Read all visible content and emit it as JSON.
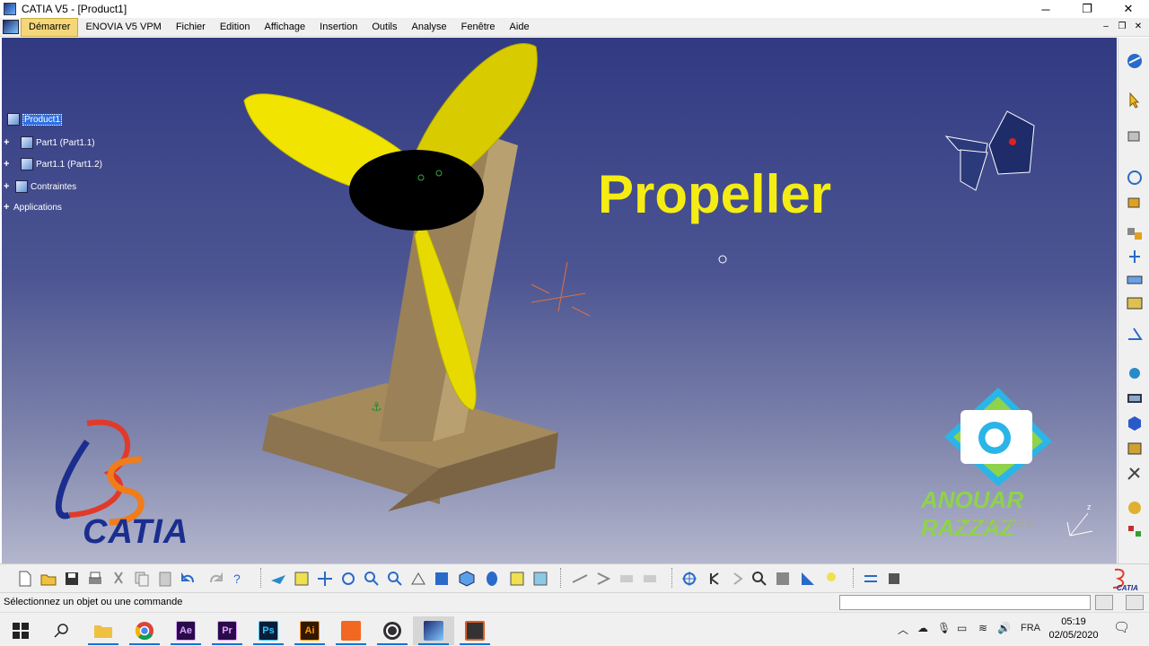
{
  "window": {
    "title": "CATIA V5 - [Product1]",
    "minimize": "─",
    "restore": "❐",
    "close": "✕"
  },
  "menu": {
    "items": [
      "Démarrer",
      "ENOVIA V5 VPM",
      "Fichier",
      "Edition",
      "Affichage",
      "Insertion",
      "Outils",
      "Analyse",
      "Fenêtre",
      "Aide"
    ],
    "mdi_minimize": "–",
    "mdi_restore": "❐",
    "mdi_close": "✕"
  },
  "tree": {
    "root": "Product1",
    "items": [
      "Part1 (Part1.1)",
      "Part1.1 (Part1.2)",
      "Contraintes",
      "Applications"
    ]
  },
  "viewport": {
    "heading": "Propeller",
    "logo_text": "CATIA",
    "watermark_title": "ANOUAR RAZZAZ",
    "watermark_subtitle": "CHANNEL",
    "compass_label": "z"
  },
  "status": {
    "message": "Sélectionnez un objet ou une commande",
    "command_value": ""
  },
  "taskbar": {
    "language": "FRA",
    "time": "05:19",
    "date": "02/05/2020",
    "apps": [
      {
        "name": "Ae",
        "color": "#2a0a4a",
        "fg": "#d9a6ff"
      },
      {
        "name": "Pr",
        "color": "#2a0a4a",
        "fg": "#e4a0ff"
      },
      {
        "name": "Ps",
        "color": "#061e3a",
        "fg": "#31c5ff"
      },
      {
        "name": "Ai",
        "color": "#331800",
        "fg": "#ff9a00"
      }
    ]
  },
  "colors": {
    "propeller_yellow": "#f5ec14",
    "catia_blue": "#1b2d8e",
    "catia_orange": "#f07c1a",
    "stand_wood": "#a58a5c",
    "accent_blue": "#0078d7"
  }
}
